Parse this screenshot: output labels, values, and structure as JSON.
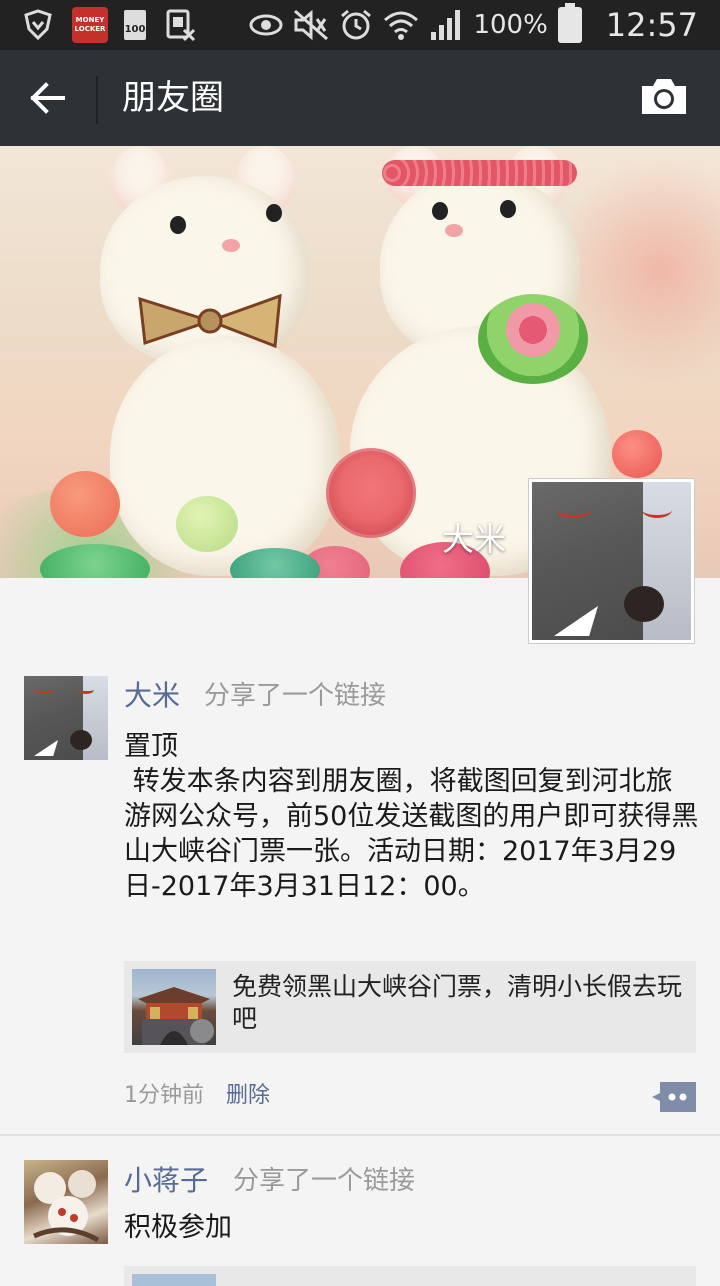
{
  "status_bar": {
    "icons": [
      "shield-icon",
      "money-locker-icon",
      "battery-100-icon",
      "sim-off-icon",
      "eye-icon",
      "mute-icon",
      "alarm-icon",
      "wifi-icon",
      "signal-icon",
      "battery-icon"
    ],
    "money_locker_text_1": "MONEY",
    "money_locker_text_2": "LOCKER",
    "battery_mini_text": "100",
    "battery_percent": "100%",
    "time": "12:57"
  },
  "header": {
    "back_icon": "arrow-left-icon",
    "title": "朋友圈",
    "camera_icon": "camera-icon"
  },
  "cover": {
    "owner_name": "大米"
  },
  "posts": [
    {
      "nickname": "大米",
      "action": "分享了一个链接",
      "text": "置顶\n 转发本条内容到朋友圈，将截图回复到河北旅游网公众号，前50位发送截图的用户即可获得黑山大峡谷门票一张。活动日期：2017年3月29日-2017年3月31日12：00。",
      "link_title": "免费领黑山大峡谷门票，清明小长假去玩吧",
      "time": "1分钟前",
      "delete_label": "删除"
    },
    {
      "nickname": "小蒋子",
      "action": "分享了一个链接",
      "text": "积极参加"
    }
  ],
  "colors": {
    "header_bg": "#2c3236",
    "status_bg": "#222222",
    "link_blue": "#576b95",
    "page_bg": "#f4f4f4"
  }
}
